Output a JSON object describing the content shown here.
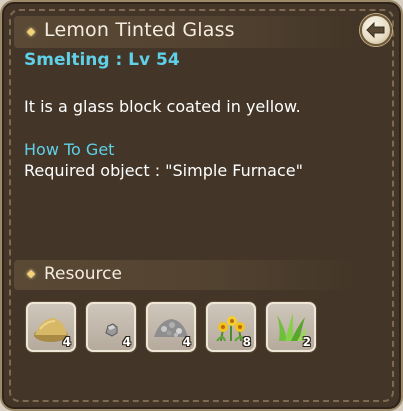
{
  "item": {
    "title": "Lemon Tinted Glass",
    "requirement": "Smelting : Lv 54",
    "description": "It is a glass block coated in yellow."
  },
  "how_to_get": {
    "label": "How To Get",
    "text": "Required object : \"Simple Furnace\""
  },
  "resource": {
    "label": "Resource",
    "items": [
      {
        "icon": "sand-pile-icon",
        "count": "4"
      },
      {
        "icon": "stone-pebble-icon",
        "count": "4"
      },
      {
        "icon": "gravel-pile-icon",
        "count": "4"
      },
      {
        "icon": "yellow-flowers-icon",
        "count": "8"
      },
      {
        "icon": "grass-icon",
        "count": "2"
      }
    ]
  },
  "colors": {
    "panel": "#433628",
    "accent_cyan": "#5fd0e8",
    "header_text": "#f4ede0"
  }
}
